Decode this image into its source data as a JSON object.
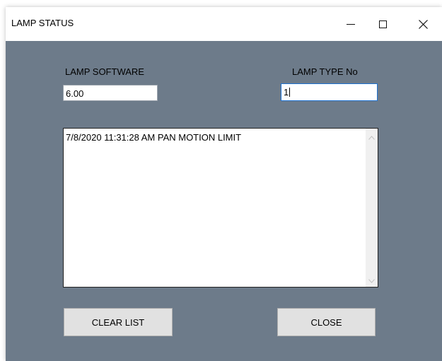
{
  "window": {
    "title": "LAMP STATUS",
    "controls": {
      "minimize": "minimize-icon",
      "maximize": "maximize-icon",
      "close": "close-icon"
    }
  },
  "fields": {
    "software_label": "LAMP SOFTWARE",
    "software_value": "6.00",
    "type_label": "LAMP TYPE No",
    "type_value": "1"
  },
  "log": {
    "items": [
      "7/8/2020 11:31:28 AM PAN MOTION LIMIT"
    ]
  },
  "buttons": {
    "clear_label": "CLEAR LIST",
    "close_label": "CLOSE"
  },
  "colors": {
    "window_bg": "#6d7b8a",
    "focus_border": "#1f72d1",
    "button_bg": "#e1e1e1"
  }
}
